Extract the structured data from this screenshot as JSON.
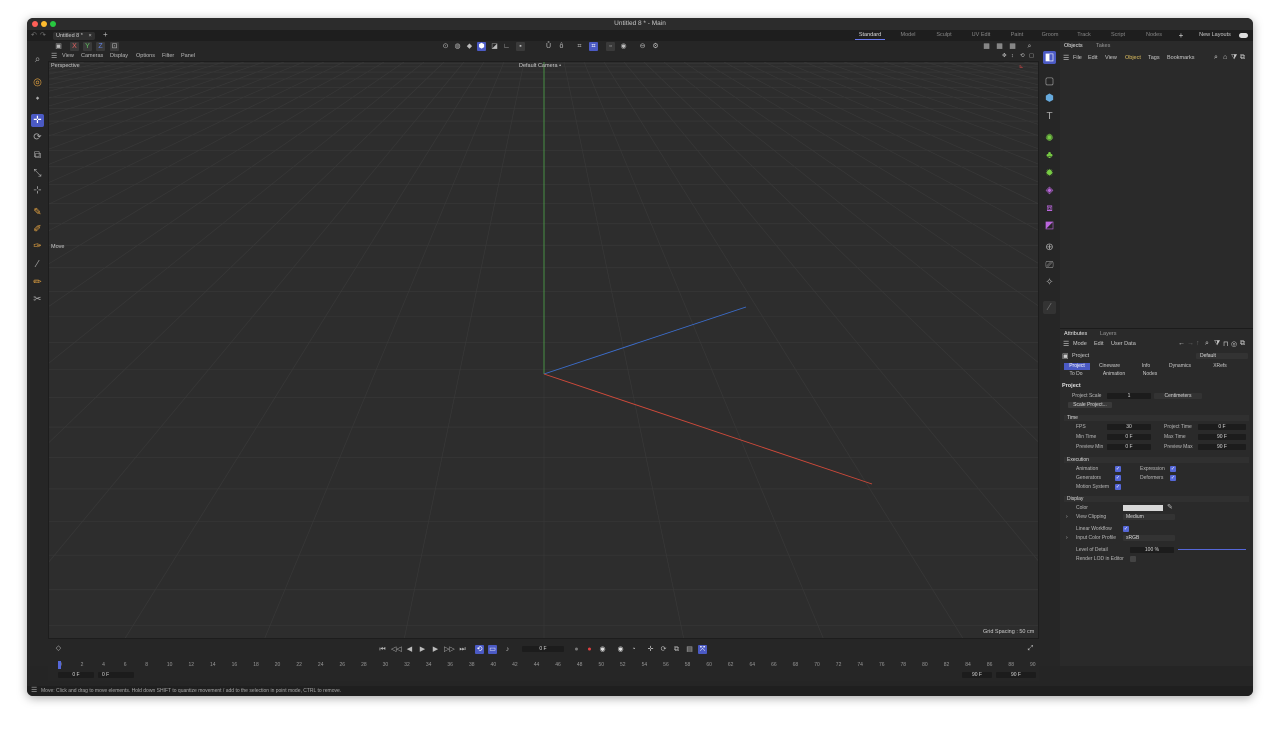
{
  "window": {
    "title": "Untitled 8 * - Main"
  },
  "doc_tab": {
    "label": "Untitled 8 *"
  },
  "layouts": [
    {
      "label": "Standard",
      "active": true
    },
    {
      "label": "Model"
    },
    {
      "label": "Sculpt"
    },
    {
      "label": "UV Edit"
    },
    {
      "label": "Paint"
    },
    {
      "label": "Groom"
    },
    {
      "label": "Track"
    },
    {
      "label": "Script"
    },
    {
      "label": "Nodes"
    }
  ],
  "new_layouts_label": "New Layouts",
  "axis_buttons": {
    "x": "X",
    "y": "Y",
    "z": "Z"
  },
  "viewport_menu": [
    "View",
    "Cameras",
    "Display",
    "Options",
    "Filter",
    "Panel"
  ],
  "viewport": {
    "projection": "Perspective",
    "camera": "Default Camera",
    "camera_icon": "•",
    "tool_label": "Move",
    "grid_spacing": "Grid Spacing : 50 cm"
  },
  "objects_panel": {
    "tabs": [
      "Objects",
      "Takes"
    ],
    "menu": [
      "File",
      "Edit",
      "View",
      "Object",
      "Tags",
      "Bookmarks"
    ]
  },
  "attributes_panel": {
    "tabs": [
      "Attributes",
      "Layers"
    ],
    "menu": [
      "Mode",
      "Edit",
      "User Data"
    ],
    "object_label": "Project",
    "preset": "Default",
    "tabs_row1": [
      "Project",
      "Cineware",
      "Info",
      "Dynamics",
      "XRefs"
    ],
    "tabs_row2": [
      "To Do",
      "Animation",
      "Nodes"
    ],
    "section_title": "Project",
    "project_scale_label": "Project Scale",
    "project_scale_value": "1",
    "project_scale_unit": "Centimeters",
    "scale_project_btn": "Scale Project...",
    "time_section": "Time",
    "fps_label": "FPS",
    "fps_value": "30",
    "project_time_label": "Project Time",
    "project_time_value": "0 F",
    "min_time_label": "Min Time",
    "min_time_value": "0 F",
    "max_time_label": "Max Time",
    "max_time_value": "90 F",
    "preview_min_label": "Preview Min",
    "preview_min_value": "0 F",
    "preview_max_label": "Preview Max",
    "preview_max_value": "90 F",
    "execution_section": "Execution",
    "animation_label": "Animation",
    "expression_label": "Expression",
    "generators_label": "Generators",
    "deformers_label": "Deformers",
    "motion_system_label": "Motion System",
    "display_section": "Display",
    "color_label": "Color",
    "view_clipping_label": "View Clipping",
    "view_clipping_value": "Medium",
    "linear_workflow_label": "Linear Workflow",
    "input_color_profile_label": "Input Color Profile",
    "input_color_profile_value": "sRGB",
    "lod_label": "Level of Detail",
    "lod_value": "100 %",
    "render_lod_label": "Render LOD in Editor"
  },
  "timeline": {
    "current_frame": "0 F",
    "start": "0 F",
    "start2": "0 F",
    "end": "90 F",
    "end2": "90 F",
    "ticks": [
      "0",
      "2",
      "4",
      "6",
      "8",
      "10",
      "12",
      "14",
      "16",
      "18",
      "20",
      "22",
      "24",
      "26",
      "28",
      "30",
      "32",
      "34",
      "36",
      "38",
      "40",
      "42",
      "44",
      "46",
      "48",
      "50",
      "52",
      "54",
      "56",
      "58",
      "60",
      "62",
      "64",
      "66",
      "68",
      "70",
      "72",
      "74",
      "76",
      "78",
      "80",
      "82",
      "84",
      "86",
      "88",
      "90"
    ]
  },
  "status": "Move: Click and drag to move elements. Hold down SHIFT to quantize movement / add to the selection in point mode, CTRL to remove.",
  "colors": {
    "accent": "#4b5ac4",
    "x_axis": "#d24a3a",
    "y_axis": "#4ea84a",
    "z_axis": "#3c6fd0"
  }
}
